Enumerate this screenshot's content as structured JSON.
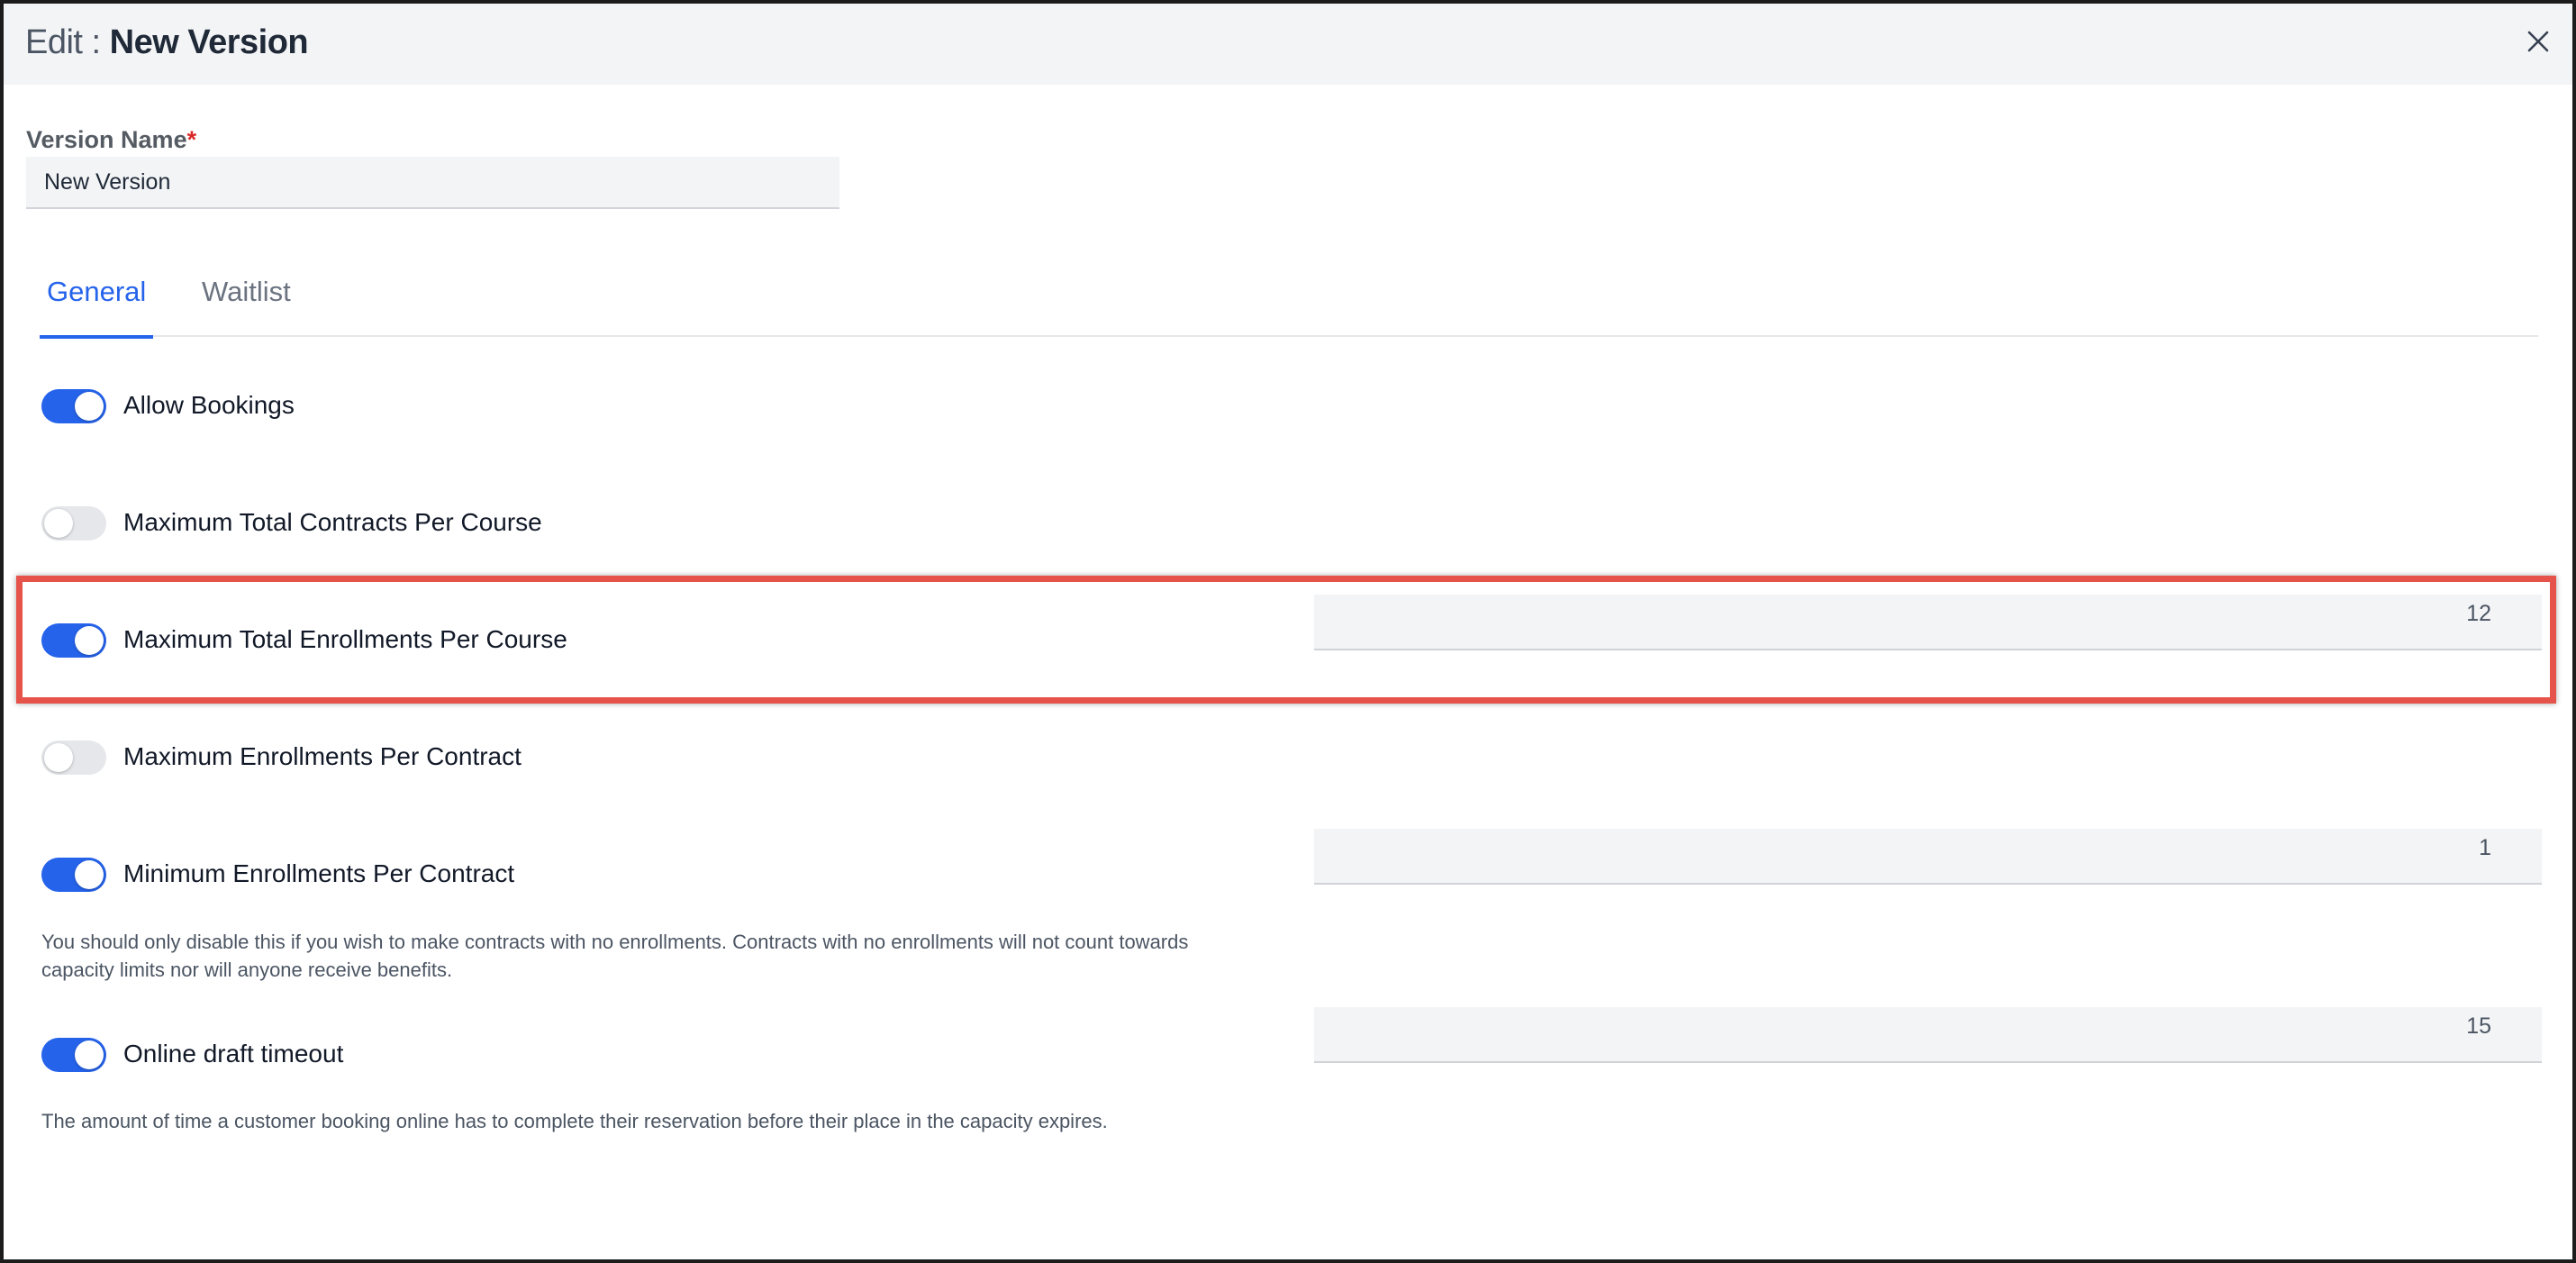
{
  "header": {
    "title_prefix": "Edit : ",
    "title_name": "New Version"
  },
  "version_name": {
    "label": "Version Name",
    "required_mark": "*",
    "value": "New Version"
  },
  "tabs": [
    {
      "label": "General",
      "active": true
    },
    {
      "label": "Waitlist",
      "active": false
    }
  ],
  "settings": {
    "allow_bookings": {
      "label": "Allow Bookings",
      "enabled": true
    },
    "max_contracts_per_course": {
      "label": "Maximum Total Contracts Per Course",
      "enabled": false
    },
    "max_enrollments_per_course": {
      "label": "Maximum Total Enrollments Per Course",
      "enabled": true,
      "value": "12"
    },
    "max_enrollments_per_contract": {
      "label": "Maximum Enrollments Per Contract",
      "enabled": false
    },
    "min_enrollments_per_contract": {
      "label": "Minimum Enrollments Per Contract",
      "enabled": true,
      "value": "1",
      "help_line1": "You should only disable this if you wish to make contracts with no enrollments. Contracts with no enrollments will not count towards",
      "help_line2": "capacity limits nor will anyone receive benefits."
    },
    "online_draft_timeout": {
      "label": "Online draft timeout",
      "enabled": true,
      "value": "15",
      "help": "The amount of time a customer booking online has to complete their reservation before their place in the capacity expires."
    }
  },
  "colors": {
    "accent": "#2563eb",
    "highlight": "#e5534b",
    "required": "#dc2626"
  }
}
